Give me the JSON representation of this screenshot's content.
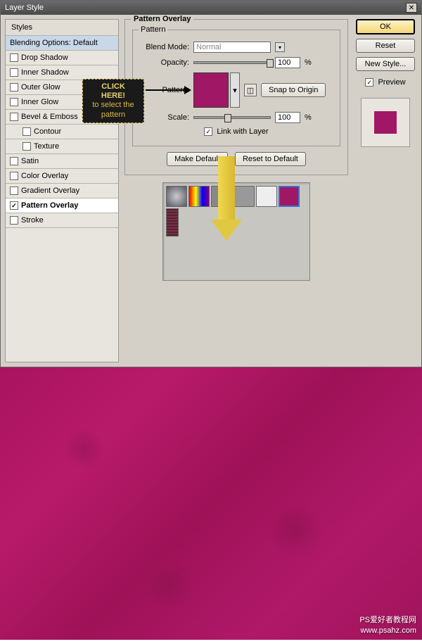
{
  "title": "Layer Style",
  "callout": {
    "title": "CLICK HERE!",
    "text": "to select the pattern"
  },
  "styles": {
    "header": "Styles",
    "blending": "Blending Options: Default",
    "items": [
      {
        "label": "Drop Shadow",
        "checked": false
      },
      {
        "label": "Inner Shadow",
        "checked": false
      },
      {
        "label": "Outer Glow",
        "checked": false
      },
      {
        "label": "Inner Glow",
        "checked": false
      },
      {
        "label": "Bevel & Emboss",
        "checked": false
      },
      {
        "label": "Contour",
        "checked": false,
        "indent": true
      },
      {
        "label": "Texture",
        "checked": false,
        "indent": true
      },
      {
        "label": "Satin",
        "checked": false
      },
      {
        "label": "Color Overlay",
        "checked": false
      },
      {
        "label": "Gradient Overlay",
        "checked": false
      },
      {
        "label": "Pattern Overlay",
        "checked": true,
        "selected": true
      },
      {
        "label": "Stroke",
        "checked": false
      }
    ]
  },
  "pattern_overlay": {
    "section_title": "Pattern Overlay",
    "inner_title": "Pattern",
    "blend_mode_label": "Blend Mode:",
    "blend_mode_value": "Normal",
    "opacity_label": "Opacity:",
    "opacity_value": "100",
    "opacity_unit": "%",
    "pattern_label": "Pattern:",
    "snap_btn": "Snap to Origin",
    "scale_label": "Scale:",
    "scale_value": "100",
    "scale_unit": "%",
    "link_label": "Link with Layer",
    "link_checked": true,
    "make_default": "Make Default",
    "reset_default": "Reset to Default"
  },
  "buttons": {
    "ok": "OK",
    "reset": "Reset",
    "new_style": "New Style...",
    "preview": "Preview",
    "preview_checked": true
  },
  "pattern_swatch_color": "#a01865",
  "watermark": {
    "line1": "PS爱好者教程网",
    "line2": "www.psahz.com"
  }
}
